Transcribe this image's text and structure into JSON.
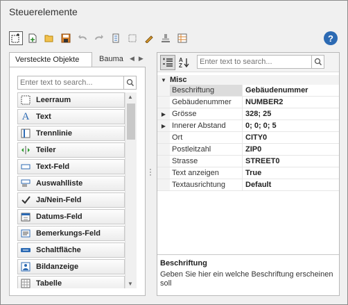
{
  "window": {
    "title": "Steuerelemente"
  },
  "toolbar": {
    "buttons": [
      "select-icon",
      "new-icon",
      "open-icon",
      "save-icon",
      "undo-icon",
      "redo-icon",
      "checklist-icon",
      "rectangle-icon",
      "pen-icon",
      "stamp-icon",
      "sheet-icon"
    ],
    "help_label": "?"
  },
  "left_panel": {
    "tabs": [
      {
        "label": "Versteckte Objekte"
      },
      {
        "label": "Bauma"
      }
    ],
    "search": {
      "placeholder": "Enter text to search..."
    },
    "items": [
      {
        "label": "Leerraum",
        "icon": "empty-space-icon"
      },
      {
        "label": "Text",
        "icon": "text-icon"
      },
      {
        "label": "Trennlinie",
        "icon": "separator-icon"
      },
      {
        "label": "Teiler",
        "icon": "splitter-icon"
      },
      {
        "label": "Text-Feld",
        "icon": "textbox-icon"
      },
      {
        "label": "Auswahlliste",
        "icon": "combobox-icon"
      },
      {
        "label": "Ja/Nein-Feld",
        "icon": "checkbox-icon"
      },
      {
        "label": "Datums-Feld",
        "icon": "calendar-icon"
      },
      {
        "label": "Bemerkungs-Feld",
        "icon": "memo-icon"
      },
      {
        "label": "Schaltfläche",
        "icon": "button-icon"
      },
      {
        "label": "Bildanzeige",
        "icon": "image-icon"
      },
      {
        "label": "Tabelle",
        "icon": "table-icon"
      }
    ]
  },
  "right_panel": {
    "search": {
      "placeholder": "Enter text to search..."
    },
    "category": "Misc",
    "properties": [
      {
        "name": "Beschriftung",
        "value": "Gebäudenummer",
        "expandable": false,
        "selected": true
      },
      {
        "name": "Gebäudenummer",
        "value": "NUMBER2",
        "expandable": false,
        "selected": false
      },
      {
        "name": "Grösse",
        "value": "328; 25",
        "expandable": true,
        "selected": false
      },
      {
        "name": "Innerer Abstand",
        "value": "0; 0; 0; 5",
        "expandable": true,
        "selected": false
      },
      {
        "name": "Ort",
        "value": "CITY0",
        "expandable": false,
        "selected": false
      },
      {
        "name": "Postleitzahl",
        "value": "ZIP0",
        "expandable": false,
        "selected": false
      },
      {
        "name": "Strasse",
        "value": "STREET0",
        "expandable": false,
        "selected": false
      },
      {
        "name": "Text anzeigen",
        "value": "True",
        "expandable": false,
        "selected": false
      },
      {
        "name": "Textausrichtung",
        "value": "Default",
        "expandable": false,
        "selected": false
      }
    ],
    "description": {
      "title": "Beschriftung",
      "text": "Geben Sie hier ein welche Beschriftung erscheinen soll"
    }
  },
  "colors": {
    "accent": "#2c6ab3",
    "selection": "#dcdcdc",
    "border": "#b8b8b8"
  }
}
